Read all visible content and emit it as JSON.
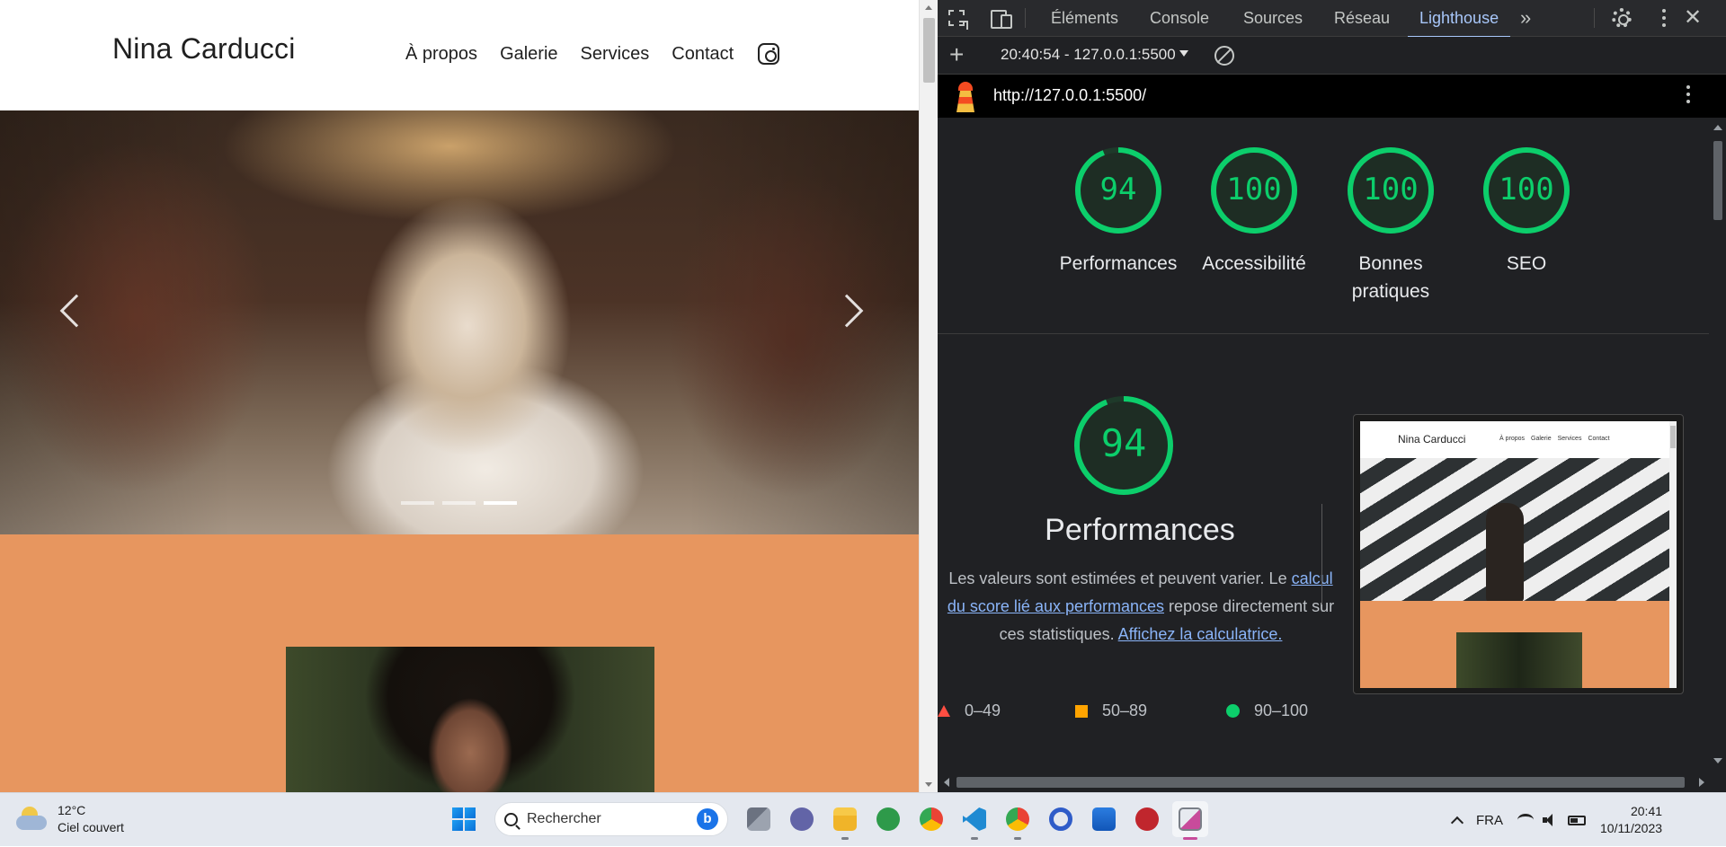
{
  "site": {
    "title": "Nina Carducci",
    "nav": [
      "À propos",
      "Galerie",
      "Services",
      "Contact"
    ],
    "carousel": {
      "slide_count": 3,
      "active_index": 2
    }
  },
  "devtools": {
    "tabs": [
      "Éléments",
      "Console",
      "Sources",
      "Réseau",
      "Lighthouse"
    ],
    "active_tab": "Lighthouse",
    "report_select": "20:40:54 - 127.0.0.1:5500",
    "url": "http://127.0.0.1:5500/",
    "scores": [
      {
        "label": "Performances",
        "score": 94
      },
      {
        "label": "Accessibilité",
        "score": 100
      },
      {
        "label": "Bonnes pratiques",
        "score": 100
      },
      {
        "label": "SEO",
        "score": 100
      }
    ],
    "perf": {
      "score": 94,
      "title": "Performances",
      "desc_before": "Les valeurs sont estimées et peuvent varier. Le ",
      "link1": "calcul du score lié aux performances",
      "desc_middle": " repose directement sur ces statistiques. ",
      "link2": "Affichez la calculatrice."
    },
    "legend": {
      "fail": "0–49",
      "average": "50–89",
      "pass": "90–100"
    },
    "thumbnail": {
      "title": "Nina Carducci",
      "nav": [
        "À propos",
        "Galerie",
        "Services",
        "Contact"
      ]
    },
    "colors": {
      "pass": "#0cce6b",
      "average": "#ffa400",
      "fail": "#ff4e42",
      "link": "#8ab4f8"
    }
  },
  "taskbar": {
    "weather_temp": "12°C",
    "weather_desc": "Ciel couvert",
    "search_label": "Rechercher",
    "lang": "FRA",
    "time": "20:41",
    "date": "10/11/2023"
  }
}
